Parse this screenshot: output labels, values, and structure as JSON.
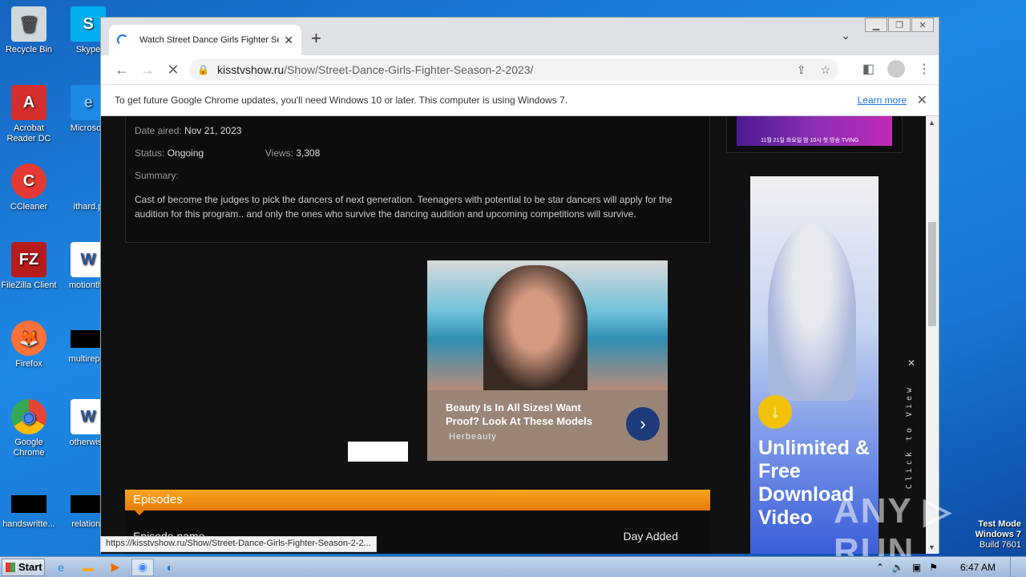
{
  "desktop": {
    "icons": [
      {
        "label": "Recycle Bin",
        "glyph": "🗑"
      },
      {
        "label": "Skype",
        "glyph": "S"
      },
      {
        "label": "Acrobat Reader DC",
        "glyph": "A"
      },
      {
        "label": "Microsoft",
        "glyph": "e"
      },
      {
        "label": "CCleaner",
        "glyph": "C"
      },
      {
        "label": "ithard.p",
        "glyph": ""
      },
      {
        "label": "FileZilla Client",
        "glyph": "FZ"
      },
      {
        "label": "motiontha",
        "glyph": "W"
      },
      {
        "label": "Firefox",
        "glyph": "🦊"
      },
      {
        "label": "multirepor",
        "glyph": ""
      },
      {
        "label": "Google Chrome",
        "glyph": "◉"
      },
      {
        "label": "otherwise",
        "glyph": "W"
      },
      {
        "label": "handswritte...",
        "glyph": ""
      },
      {
        "label": "relations",
        "glyph": ""
      }
    ]
  },
  "browser": {
    "tab_title": "Watch Street Dance Girls Fighter Se",
    "new_tab": "+",
    "url_domain": "kisstvshow.ru",
    "url_path": "/Show/Street-Dance-Girls-Fighter-Season-2-2023/",
    "infobar_text": "To get future Google Chrome updates, you'll need Windows 10 or later. This computer is using Windows 7.",
    "infobar_link": "Learn more",
    "status_url": "https://kisstvshow.ru/Show/Street-Dance-Girls-Fighter-Season-2-2..."
  },
  "page": {
    "date_label": "Date aired:",
    "date_value": "Nov 21, 2023",
    "status_label": "Status:",
    "status_value": "Ongoing",
    "views_label": "Views:",
    "views_value": "3,308",
    "summary_label": "Summary:",
    "summary_text": "Cast of become the judges to pick the dancers of next generation. Teenagers with potential to be star dancers will apply for the audition for this program.. and only the ones who survive the dancing audition and upcoming competitions will survive.",
    "episodes_title": "Episodes",
    "col_name": "Episode name",
    "col_date": "Day Added"
  },
  "ads": {
    "ad1_text": "Beauty Is In All Sizes! Want Proof? Look At These Models",
    "ad1_brand": "Herbeauty",
    "ad2_headline": "Unlimited & Free Download Video",
    "ad2_side": "Click to View",
    "ad_top_text": "11월 21일 화요일 밤 10시 첫 방송 TVING"
  },
  "overlay": {
    "watermark": "ANY ▷ RUN",
    "test_mode": [
      "Test Mode",
      "Windows 7",
      "Build 7601"
    ]
  },
  "taskbar": {
    "start_label": "Start",
    "clock": "6:47 AM"
  }
}
